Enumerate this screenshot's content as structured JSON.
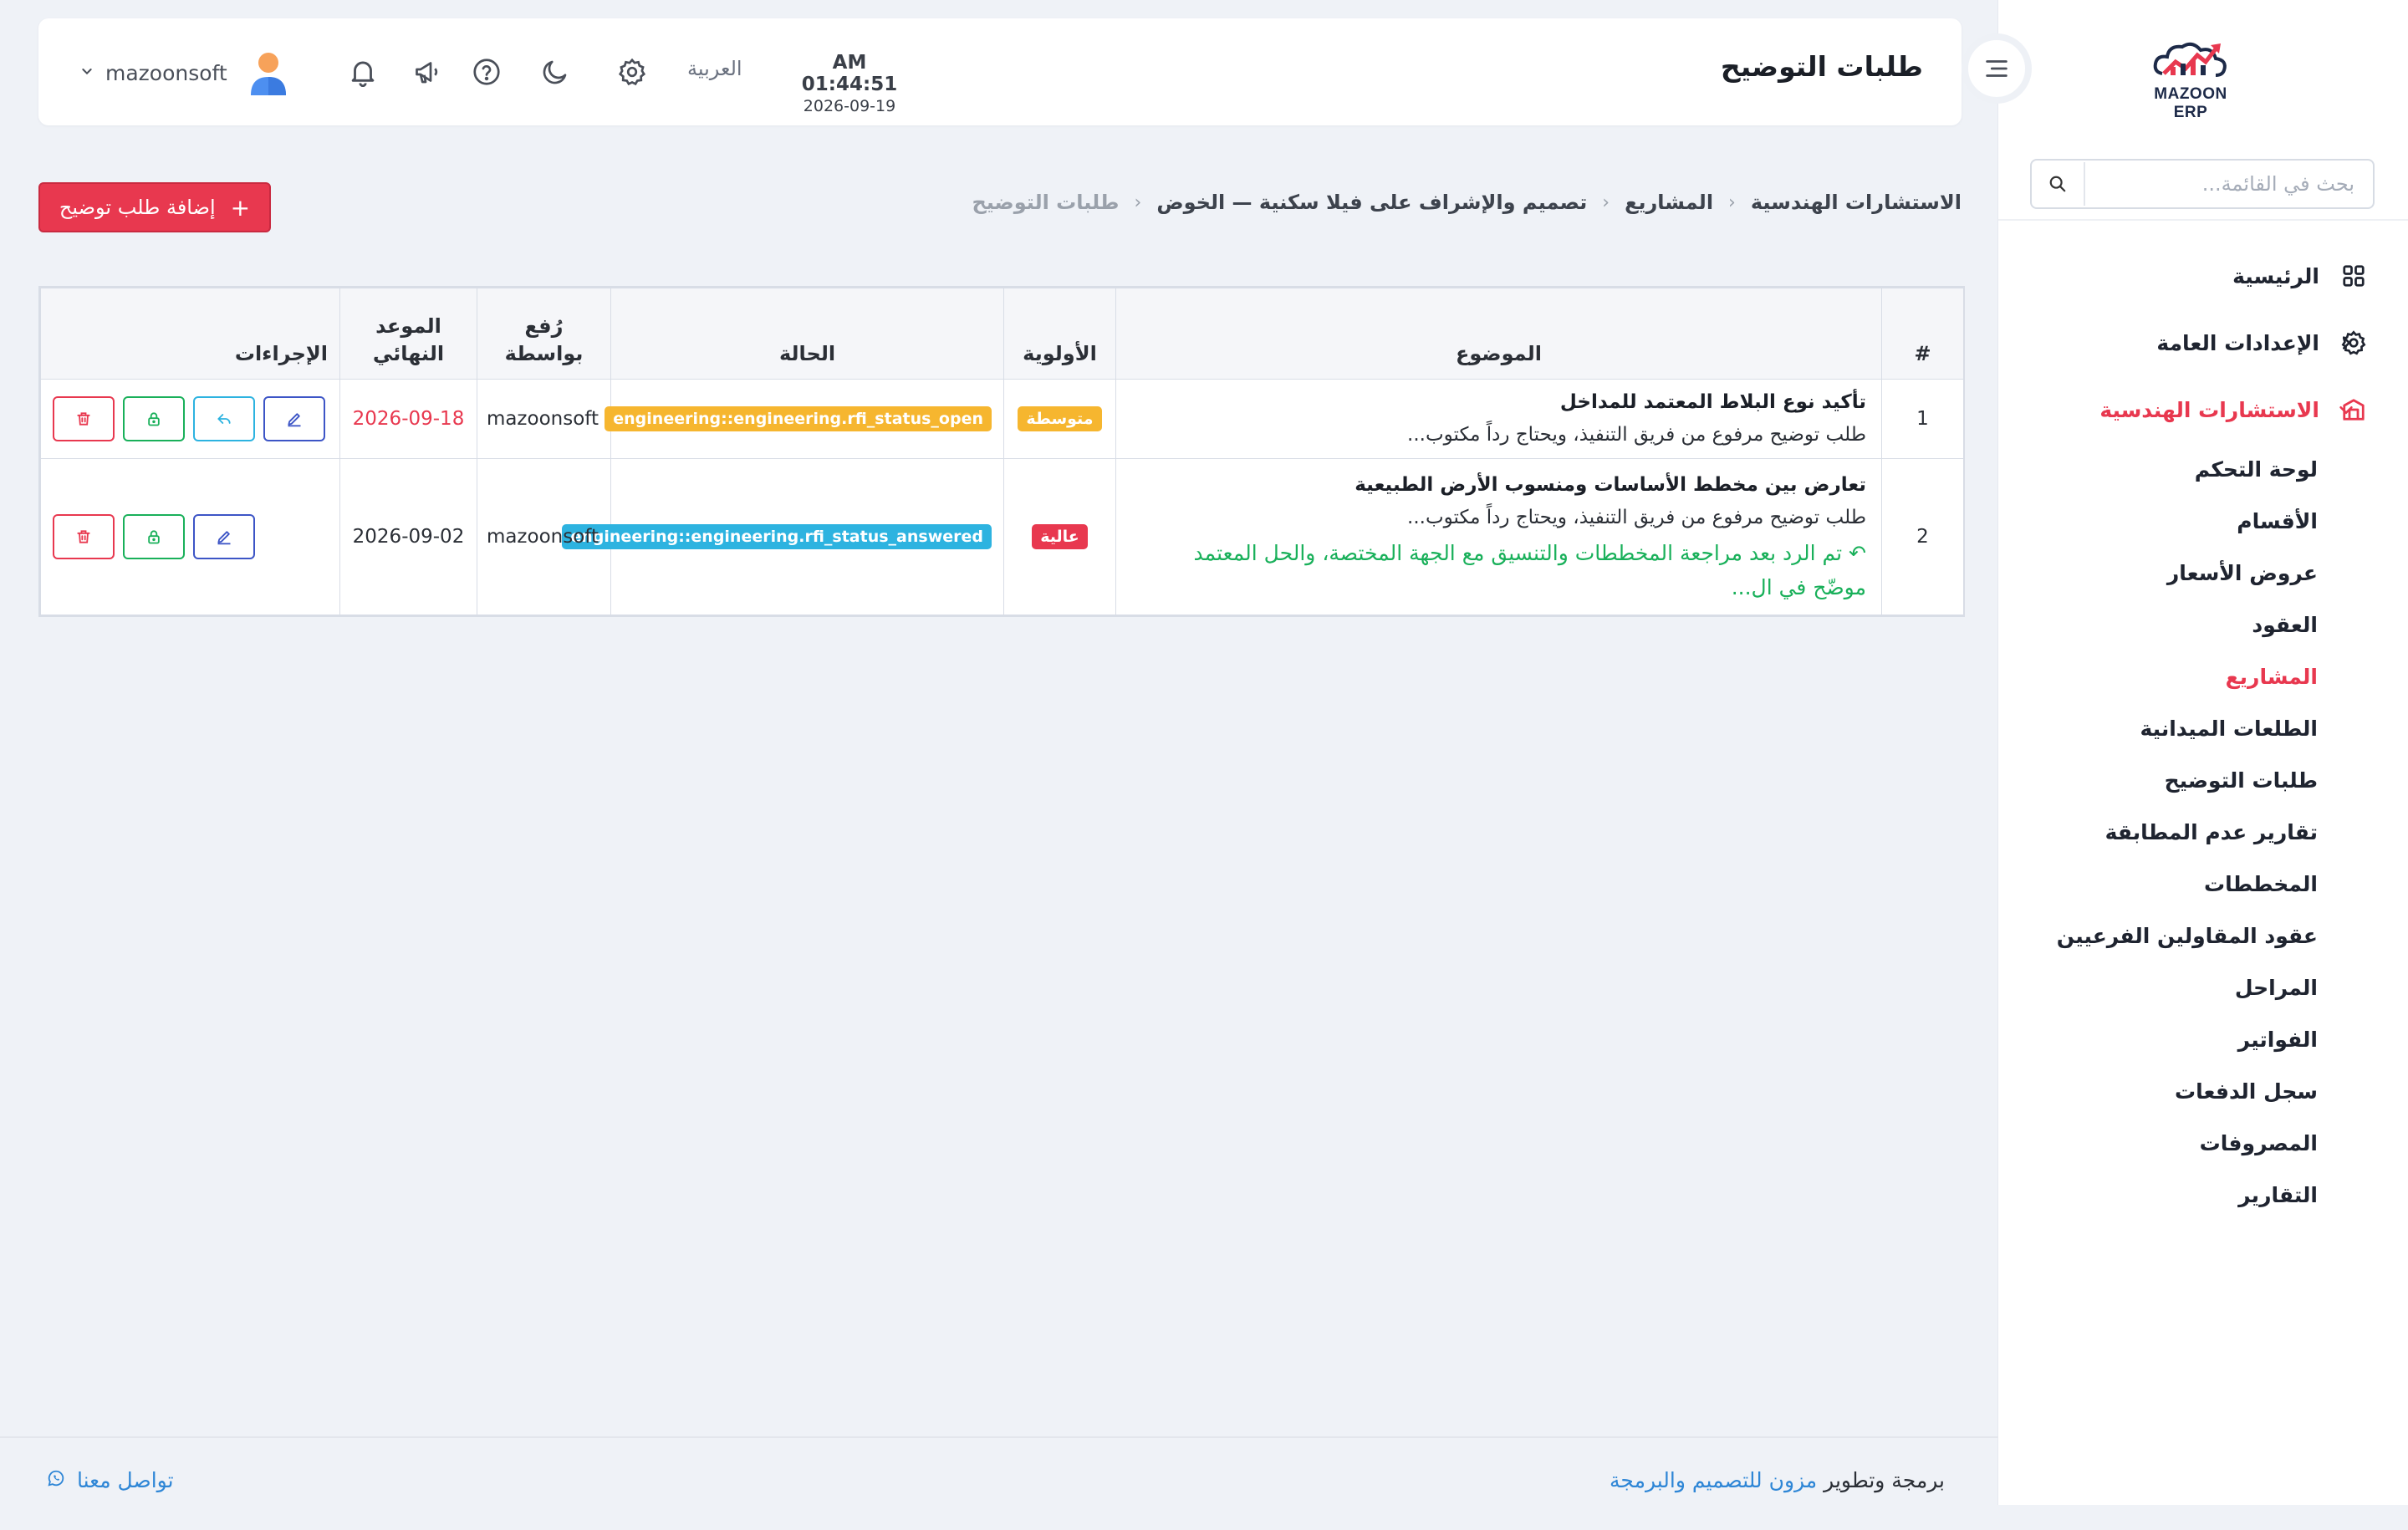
{
  "brand": {
    "logo_text": "MAZOON ERP"
  },
  "sidebar": {
    "search_placeholder": "بحث في القائمة...",
    "items": [
      {
        "label": "الرئيسية",
        "icon": "grid-icon"
      },
      {
        "label": "الإعدادات العامة",
        "icon": "gear-icon"
      },
      {
        "label": "الاستشارات الهندسية",
        "icon": "building-icon",
        "active": true
      }
    ],
    "subitems": [
      "لوحة التحكم",
      "الأقسام",
      "عروض الأسعار",
      "العقود",
      "المشاريع",
      "الطلعات الميدانية",
      "طلبات التوضيح",
      "تقارير عدم المطابقة",
      "المخططات",
      "عقود المقاولين الفرعيين",
      "المراحل",
      "الفواتير",
      "سجل الدفعات",
      "المصروفات",
      "التقارير"
    ],
    "active_subitem": "المشاريع"
  },
  "header": {
    "title": "طلبات التوضيح",
    "time": "AM 01:44:51",
    "date": "2026-09-19",
    "language": "العربية",
    "username": "mazoonsoft"
  },
  "breadcrumb": [
    "الاستشارات الهندسية",
    "المشاريع",
    "تصميم والإشراف على فيلا سكنية — الخوض",
    "طلبات التوضيح"
  ],
  "add_button": {
    "label": "إضافة طلب توضيح"
  },
  "table": {
    "headers": {
      "num": "#",
      "subject": "الموضوع",
      "priority": "الأولوية",
      "status": "الحالة",
      "raised_by_1": "رُفع",
      "raised_by_2": "بواسطة",
      "due_1": "الموعد",
      "due_2": "النهائي",
      "actions": "الإجراءات"
    },
    "rows": [
      {
        "num": "1",
        "title": "تأكيد نوع البلاط المعتمد للمداخل",
        "desc": "طلب توضيح مرفوع من فريق التنفيذ، ويحتاج رداً مكتوب...",
        "priority": "متوسطة",
        "status": "engineering::engineering.rfi_status_open",
        "raised_by": "mazoonsoft",
        "due": "2026-09-18"
      },
      {
        "num": "2",
        "title": "تعارض بين مخطط الأساسات ومنسوب الأرض الطبيعية",
        "desc": "طلب توضيح مرفوع من فريق التنفيذ، ويحتاج رداً مكتوب...",
        "reply_1": "تم الرد بعد مراجعة المخططات والتنسيق مع الجهة المختصة، والحل المعتمد",
        "reply_2": "موضّح في ال...",
        "priority": "عالية",
        "status": "engineering::engineering.rfi_status_answered",
        "raised_by": "mazoonsoft",
        "due": "2026-09-02"
      }
    ]
  },
  "footer": {
    "credit_prefix": "برمجة وتطوير",
    "credit_link": "مزون للتصميم والبرمجة",
    "contact": "تواصل معنا"
  },
  "colors": {
    "accent": "#e8384f",
    "success": "#19b05a",
    "info": "#2db3e0",
    "warning": "#f6b62f",
    "primary": "#3d55c6"
  }
}
